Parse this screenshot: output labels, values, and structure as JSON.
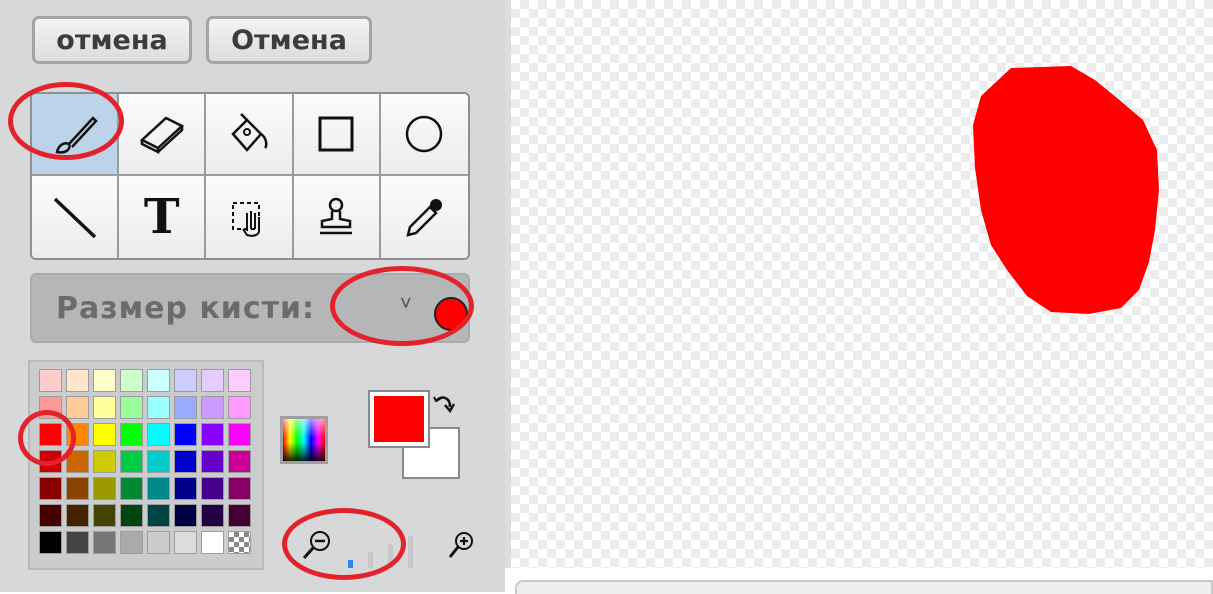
{
  "toolbar": {
    "undo_label": "отмена",
    "cancel_label": "Отмена"
  },
  "tools": [
    {
      "name": "brush-icon",
      "active": true
    },
    {
      "name": "eraser-icon"
    },
    {
      "name": "fill-icon"
    },
    {
      "name": "rectangle-icon"
    },
    {
      "name": "ellipse-icon"
    },
    {
      "name": "line-icon"
    },
    {
      "name": "text-icon",
      "glyph": "T"
    },
    {
      "name": "select-icon"
    },
    {
      "name": "stamp-icon"
    },
    {
      "name": "eyedropper-icon"
    }
  ],
  "brush": {
    "label": "Размер кисти:",
    "chevron": "˅",
    "color": "#ff0000"
  },
  "palette": {
    "colors": [
      "#ffcccc",
      "#ffe5cc",
      "#ffffcc",
      "#ccffcc",
      "#ccffff",
      "#ccccff",
      "#e5ccff",
      "#ffccff",
      "#ff9999",
      "#ffcc99",
      "#ffff99",
      "#99ff99",
      "#99ffff",
      "#99aaff",
      "#cc99ff",
      "#ff99ff",
      "#ff0000",
      "#ff8800",
      "#ffff00",
      "#00ff00",
      "#00ffff",
      "#0000ff",
      "#8800ff",
      "#ff00ff",
      "#cc0000",
      "#cc6600",
      "#cccc00",
      "#00cc44",
      "#00cccc",
      "#0000cc",
      "#6600cc",
      "#cc0099",
      "#880000",
      "#884400",
      "#999900",
      "#008833",
      "#008888",
      "#000088",
      "#440088",
      "#880066",
      "#440000",
      "#442200",
      "#444400",
      "#004411",
      "#004444",
      "#000044",
      "#220044",
      "#440033",
      "#000000",
      "#444444",
      "#777777",
      "#aaaaaa",
      "#cccccc",
      "#dddddd",
      "#ffffff",
      "checker"
    ],
    "selected_index": 16
  },
  "current_colors": {
    "primary": "#ff0000",
    "secondary": "#ffffff"
  },
  "zoom": {
    "level_index": 0,
    "levels": 4
  },
  "canvas": {
    "shape_color": "#ff0000"
  }
}
